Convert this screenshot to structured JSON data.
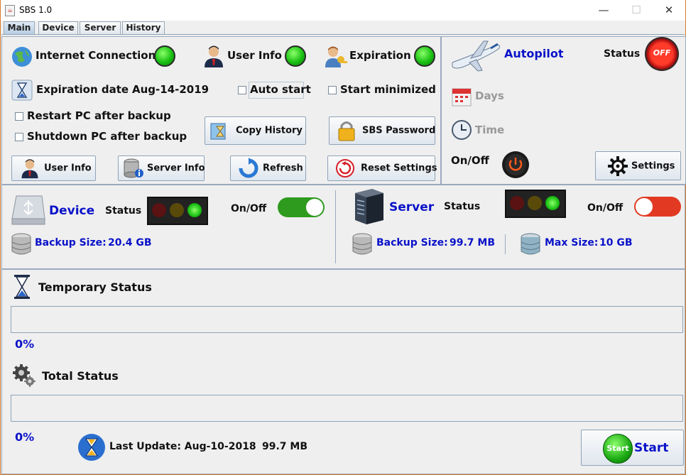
{
  "window": {
    "title": "SBS 1.0",
    "minimize": "—",
    "maximize": "☐",
    "close": "✕"
  },
  "tabs": [
    {
      "label": "Main",
      "active": true
    },
    {
      "label": "Device",
      "active": false
    },
    {
      "label": "Server",
      "active": false
    },
    {
      "label": "History",
      "active": false
    }
  ],
  "status": {
    "internet": "Internet Connection",
    "user_info": "User Info",
    "expiration": "Expiration"
  },
  "expiration": {
    "label": "Expiration date",
    "date": "Aug-14-2019"
  },
  "options": {
    "auto_start": "Auto start",
    "start_minimized": "Start minimized",
    "restart_pc": "Restart PC after backup",
    "shutdown_pc": "Shutdown PC after backup"
  },
  "buttons": {
    "copy_history": "Copy History",
    "sbs_password": "SBS Password",
    "user_info": "User Info",
    "server_info": "Server Info",
    "refresh": "Refresh",
    "reset_settings": "Reset Settings",
    "settings": "Settings",
    "start_icon": "Start",
    "start": "Start"
  },
  "autopilot": {
    "title": "Autopilot",
    "status_label": "Status",
    "status_badge": "OFF",
    "days": "Days",
    "time": "Time",
    "onoff": "On/Off"
  },
  "device": {
    "title": "Device",
    "status_label": "Status",
    "onoff": "On/Off",
    "toggle_on": true,
    "backup_label": "Backup Size:",
    "backup_size": "20.4 GB"
  },
  "server": {
    "title": "Server",
    "status_label": "Status",
    "onoff": "On/Off",
    "toggle_on": false,
    "backup_label": "Backup Size:",
    "backup_size": "99.7 MB",
    "max_label": "Max Size:",
    "max_size": "10 GB"
  },
  "progress": {
    "temporary_label": "Temporary Status",
    "temporary_pct": "0%",
    "temporary_value": 0,
    "total_label": "Total Status",
    "total_pct": "0%",
    "total_value": 0
  },
  "footer": {
    "last_update": "Last Update: Aug-10-2018",
    "size": "99.7 MB"
  },
  "colors": {
    "accent": "#0a12c8",
    "led_green": "#19c012",
    "toggle_on": "#2e9a1e",
    "toggle_off": "#e23a22"
  }
}
